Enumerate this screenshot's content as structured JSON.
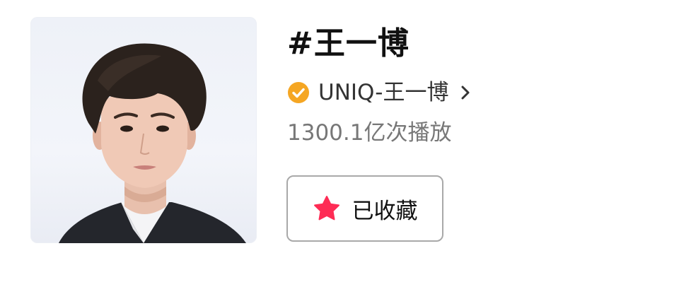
{
  "topic": {
    "title": "#王一博",
    "creator_name": "UNIQ-王一博",
    "play_count": "1300.1亿次播放",
    "favorite_button_label": "已收藏"
  },
  "icons": {
    "verified": "verified-check-icon",
    "chevron": "chevron-right-icon",
    "favorite": "star-icon"
  },
  "colors": {
    "verified_badge": "#F5A623",
    "star": "#FE2C55",
    "title_text": "#111111",
    "secondary_text": "#777777"
  }
}
